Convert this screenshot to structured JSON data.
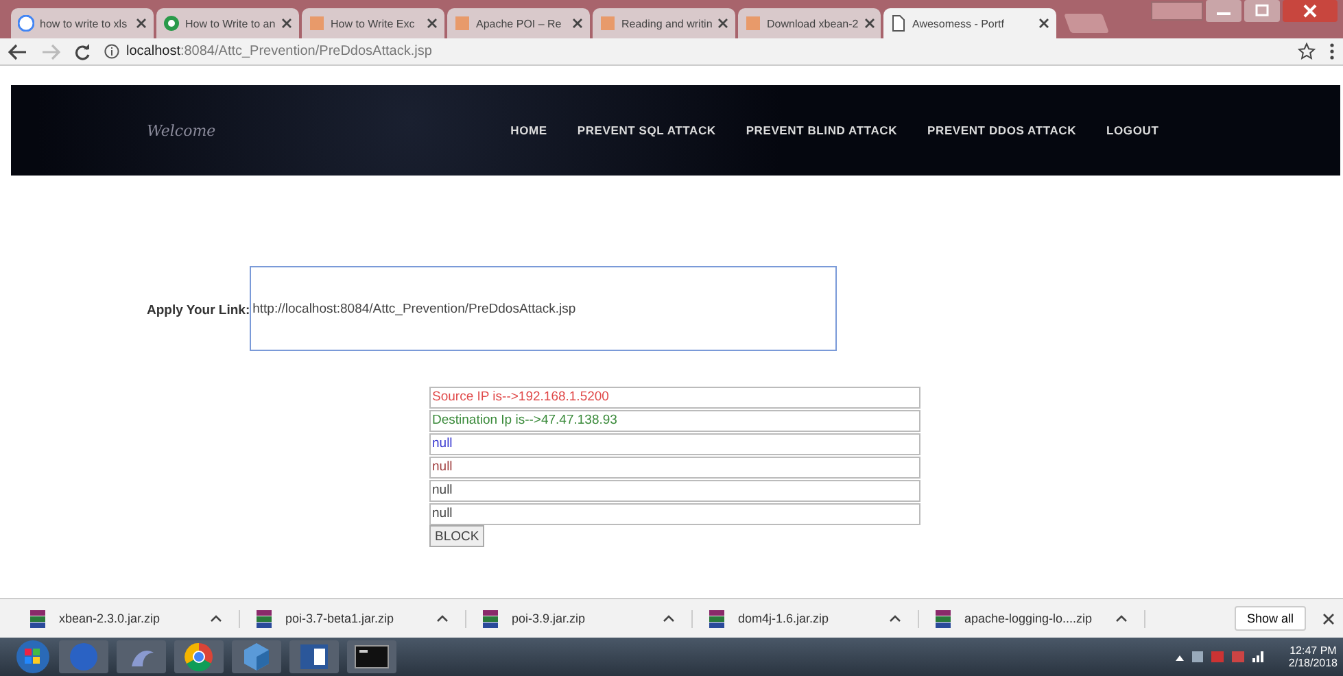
{
  "browser": {
    "tabs": [
      {
        "title": "how to write to xls",
        "selected": false
      },
      {
        "title": "How to Write to an",
        "selected": false
      },
      {
        "title": "How to Write Exc",
        "selected": false
      },
      {
        "title": "Apache POI – Re",
        "selected": false
      },
      {
        "title": "Reading and writin",
        "selected": false
      },
      {
        "title": "Download xbean-2",
        "selected": false
      },
      {
        "title": "Awesomess - Portf",
        "selected": true
      }
    ],
    "address": {
      "host": "localhost",
      "path": ":8084/Attc_Prevention/PreDdosAttack.jsp"
    }
  },
  "page": {
    "brand": "Welcome",
    "nav": [
      "HOME",
      "PREVENT SQL ATTACK",
      "PREVENT BLIND ATTACK",
      "PREVENT DDOS ATTACK",
      "LOGOUT"
    ],
    "link_label": "Apply Your Link:",
    "link_value": "http://localhost:8084/Attc_Prevention/PreDdosAttack.jsp",
    "results": [
      {
        "text": "Source IP is-->192.168.1.5200",
        "color": "#e04a4a"
      },
      {
        "text": "Destination Ip is-->47.47.138.93",
        "color": "#3a8a3a"
      },
      {
        "text": "null",
        "color": "#3a3ad0"
      },
      {
        "text": "null",
        "color": "#a04040"
      },
      {
        "text": "null",
        "color": "#444444"
      },
      {
        "text": "null",
        "color": "#444444"
      }
    ],
    "block_button": "BLOCK"
  },
  "downloads": {
    "items": [
      "xbean-2.3.0.jar.zip",
      "poi-3.7-beta1.jar.zip",
      "poi-3.9.jar.zip",
      "dom4j-1.6.jar.zip",
      "apache-logging-lo....zip"
    ],
    "show_all": "Show all"
  },
  "taskbar": {
    "time": "12:47 PM",
    "date": "2/18/2018"
  }
}
